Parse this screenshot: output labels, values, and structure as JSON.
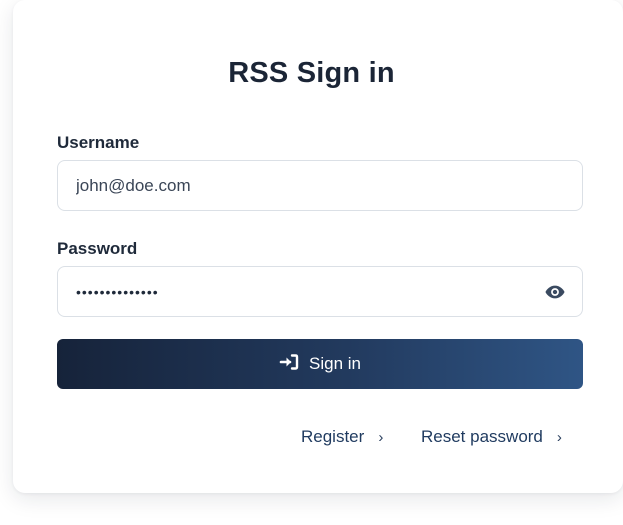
{
  "form": {
    "title": "RSS Sign in",
    "username": {
      "label": "Username",
      "value": "john@doe.com"
    },
    "password": {
      "label": "Password",
      "value": "••••••••••••••",
      "toggle_icon": "eye-icon"
    },
    "submit": {
      "label": "Sign in",
      "icon": "sign-in-icon"
    },
    "links": {
      "register": "Register",
      "reset_password": "Reset password",
      "chevron": "›"
    }
  },
  "colors": {
    "button_gradient_start": "#16233a",
    "button_gradient_end": "#2f5585",
    "link": "#1f3a5f",
    "border": "#dbe0e6"
  }
}
